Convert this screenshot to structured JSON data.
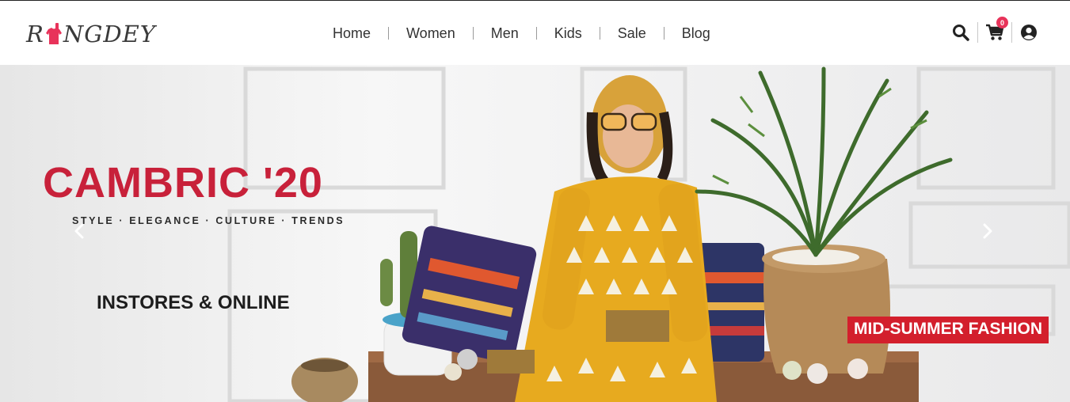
{
  "brand": {
    "logo_text_left": "R",
    "logo_text_right": "NGDEY",
    "color": "#e8335a"
  },
  "nav": {
    "items": [
      {
        "label": "Home"
      },
      {
        "label": "Women"
      },
      {
        "label": "Men"
      },
      {
        "label": "Kids"
      },
      {
        "label": "Sale"
      },
      {
        "label": "Blog"
      }
    ]
  },
  "header_icons": {
    "search": "search-icon",
    "cart": "shopping-cart-icon",
    "cart_count": "0",
    "account": "user-circle-icon"
  },
  "hero": {
    "title": "CAMBRIC '20",
    "tagline": "STYLE · ELEGANCE · CULTURE · TRENDS",
    "subtitle": "INSTORES & ONLINE",
    "badge": "MID-SUMMER FASHION",
    "prev_icon": "chevron-left-icon",
    "next_icon": "chevron-right-icon",
    "title_color": "#c8213a",
    "badge_color": "#d31f2c"
  }
}
